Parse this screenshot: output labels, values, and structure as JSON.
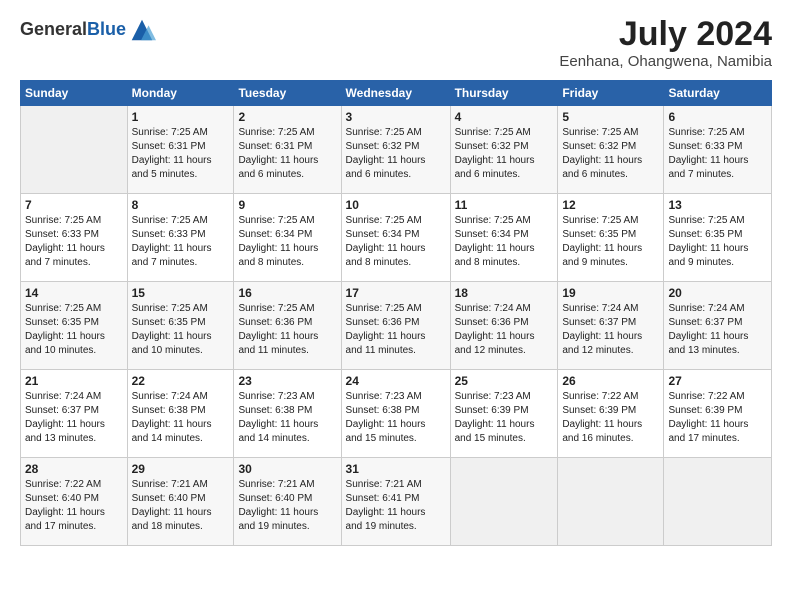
{
  "header": {
    "logo_general": "General",
    "logo_blue": "Blue",
    "month_year": "July 2024",
    "location": "Eenhana, Ohangwena, Namibia"
  },
  "days_of_week": [
    "Sunday",
    "Monday",
    "Tuesday",
    "Wednesday",
    "Thursday",
    "Friday",
    "Saturday"
  ],
  "weeks": [
    [
      {
        "day": "",
        "content": ""
      },
      {
        "day": "1",
        "content": "Sunrise: 7:25 AM\nSunset: 6:31 PM\nDaylight: 11 hours\nand 5 minutes."
      },
      {
        "day": "2",
        "content": "Sunrise: 7:25 AM\nSunset: 6:31 PM\nDaylight: 11 hours\nand 6 minutes."
      },
      {
        "day": "3",
        "content": "Sunrise: 7:25 AM\nSunset: 6:32 PM\nDaylight: 11 hours\nand 6 minutes."
      },
      {
        "day": "4",
        "content": "Sunrise: 7:25 AM\nSunset: 6:32 PM\nDaylight: 11 hours\nand 6 minutes."
      },
      {
        "day": "5",
        "content": "Sunrise: 7:25 AM\nSunset: 6:32 PM\nDaylight: 11 hours\nand 6 minutes."
      },
      {
        "day": "6",
        "content": "Sunrise: 7:25 AM\nSunset: 6:33 PM\nDaylight: 11 hours\nand 7 minutes."
      }
    ],
    [
      {
        "day": "7",
        "content": "Sunrise: 7:25 AM\nSunset: 6:33 PM\nDaylight: 11 hours\nand 7 minutes."
      },
      {
        "day": "8",
        "content": "Sunrise: 7:25 AM\nSunset: 6:33 PM\nDaylight: 11 hours\nand 7 minutes."
      },
      {
        "day": "9",
        "content": "Sunrise: 7:25 AM\nSunset: 6:34 PM\nDaylight: 11 hours\nand 8 minutes."
      },
      {
        "day": "10",
        "content": "Sunrise: 7:25 AM\nSunset: 6:34 PM\nDaylight: 11 hours\nand 8 minutes."
      },
      {
        "day": "11",
        "content": "Sunrise: 7:25 AM\nSunset: 6:34 PM\nDaylight: 11 hours\nand 8 minutes."
      },
      {
        "day": "12",
        "content": "Sunrise: 7:25 AM\nSunset: 6:35 PM\nDaylight: 11 hours\nand 9 minutes."
      },
      {
        "day": "13",
        "content": "Sunrise: 7:25 AM\nSunset: 6:35 PM\nDaylight: 11 hours\nand 9 minutes."
      }
    ],
    [
      {
        "day": "14",
        "content": "Sunrise: 7:25 AM\nSunset: 6:35 PM\nDaylight: 11 hours\nand 10 minutes."
      },
      {
        "day": "15",
        "content": "Sunrise: 7:25 AM\nSunset: 6:35 PM\nDaylight: 11 hours\nand 10 minutes."
      },
      {
        "day": "16",
        "content": "Sunrise: 7:25 AM\nSunset: 6:36 PM\nDaylight: 11 hours\nand 11 minutes."
      },
      {
        "day": "17",
        "content": "Sunrise: 7:25 AM\nSunset: 6:36 PM\nDaylight: 11 hours\nand 11 minutes."
      },
      {
        "day": "18",
        "content": "Sunrise: 7:24 AM\nSunset: 6:36 PM\nDaylight: 11 hours\nand 12 minutes."
      },
      {
        "day": "19",
        "content": "Sunrise: 7:24 AM\nSunset: 6:37 PM\nDaylight: 11 hours\nand 12 minutes."
      },
      {
        "day": "20",
        "content": "Sunrise: 7:24 AM\nSunset: 6:37 PM\nDaylight: 11 hours\nand 13 minutes."
      }
    ],
    [
      {
        "day": "21",
        "content": "Sunrise: 7:24 AM\nSunset: 6:37 PM\nDaylight: 11 hours\nand 13 minutes."
      },
      {
        "day": "22",
        "content": "Sunrise: 7:24 AM\nSunset: 6:38 PM\nDaylight: 11 hours\nand 14 minutes."
      },
      {
        "day": "23",
        "content": "Sunrise: 7:23 AM\nSunset: 6:38 PM\nDaylight: 11 hours\nand 14 minutes."
      },
      {
        "day": "24",
        "content": "Sunrise: 7:23 AM\nSunset: 6:38 PM\nDaylight: 11 hours\nand 15 minutes."
      },
      {
        "day": "25",
        "content": "Sunrise: 7:23 AM\nSunset: 6:39 PM\nDaylight: 11 hours\nand 15 minutes."
      },
      {
        "day": "26",
        "content": "Sunrise: 7:22 AM\nSunset: 6:39 PM\nDaylight: 11 hours\nand 16 minutes."
      },
      {
        "day": "27",
        "content": "Sunrise: 7:22 AM\nSunset: 6:39 PM\nDaylight: 11 hours\nand 17 minutes."
      }
    ],
    [
      {
        "day": "28",
        "content": "Sunrise: 7:22 AM\nSunset: 6:40 PM\nDaylight: 11 hours\nand 17 minutes."
      },
      {
        "day": "29",
        "content": "Sunrise: 7:21 AM\nSunset: 6:40 PM\nDaylight: 11 hours\nand 18 minutes."
      },
      {
        "day": "30",
        "content": "Sunrise: 7:21 AM\nSunset: 6:40 PM\nDaylight: 11 hours\nand 19 minutes."
      },
      {
        "day": "31",
        "content": "Sunrise: 7:21 AM\nSunset: 6:41 PM\nDaylight: 11 hours\nand 19 minutes."
      },
      {
        "day": "",
        "content": ""
      },
      {
        "day": "",
        "content": ""
      },
      {
        "day": "",
        "content": ""
      }
    ]
  ]
}
